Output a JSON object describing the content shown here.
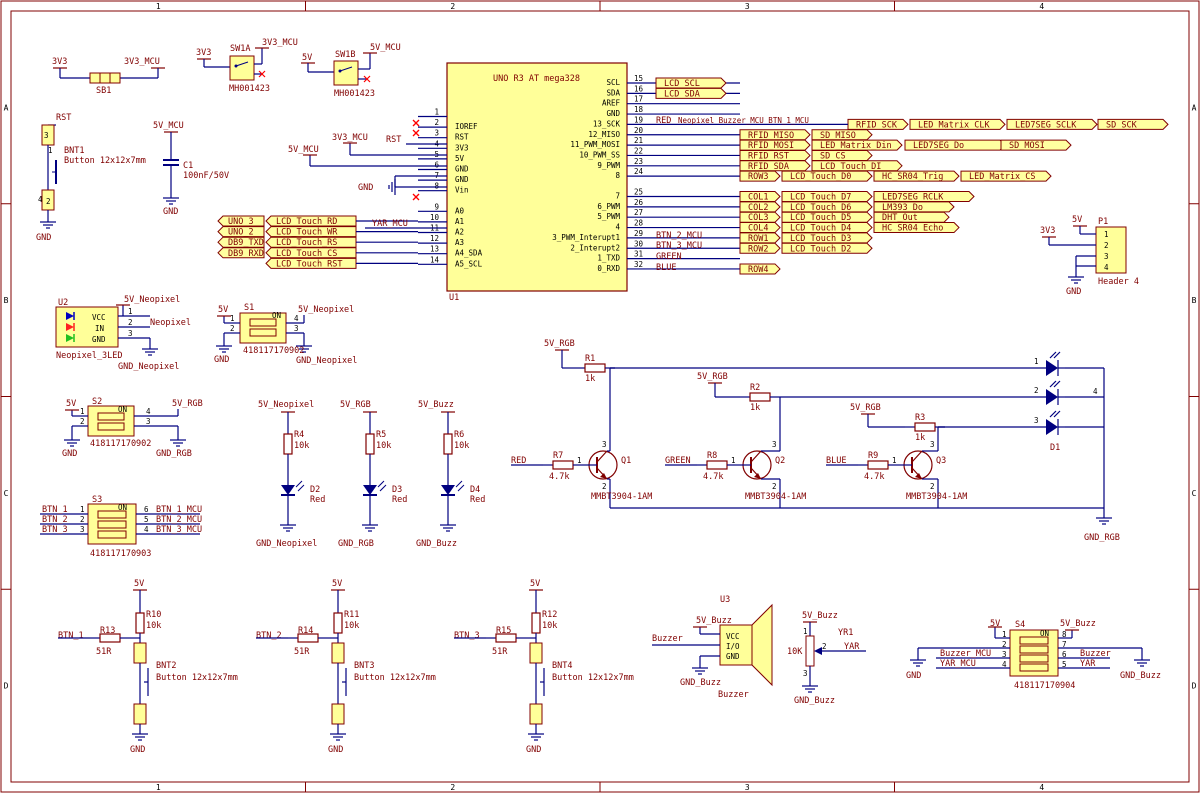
{
  "colors": {
    "wire": "#000080",
    "label": "#800000",
    "body": "#ffff99",
    "body_border": "#800000",
    "port_fill": "#ffffa0",
    "frame": "#800000",
    "nc": "#ff0000"
  },
  "frame": {
    "columns": [
      "1",
      "2",
      "3",
      "4"
    ],
    "rows": [
      "A",
      "B",
      "C",
      "D"
    ]
  },
  "u1": {
    "ref": "U1",
    "title": "UNO R3 AT mega328",
    "left_pins": [
      {
        "num": "1",
        "name": "",
        "net": ""
      },
      {
        "num": "2",
        "name": "IOREF",
        "net": ""
      },
      {
        "num": "3",
        "name": "RST",
        "net": "RST"
      },
      {
        "num": "4",
        "name": "3V3",
        "net": "3V3_MCU"
      },
      {
        "num": "5",
        "name": "5V",
        "net": "5V_MCU"
      },
      {
        "num": "6",
        "name": "GND",
        "net": ""
      },
      {
        "num": "7",
        "name": "GND",
        "net": ""
      },
      {
        "num": "8",
        "name": "Vin",
        "net": ""
      },
      {
        "num": "9",
        "name": "A0",
        "net": ""
      },
      {
        "num": "10",
        "name": "A1",
        "net": "YAR_MCU"
      },
      {
        "num": "11",
        "name": "A2",
        "net": ""
      },
      {
        "num": "12",
        "name": "A3",
        "net": ""
      },
      {
        "num": "13",
        "name": "A4_SDA",
        "net": ""
      },
      {
        "num": "14",
        "name": "A5_SCL",
        "net": ""
      }
    ],
    "gnd_label": "GND",
    "right_pins": [
      {
        "num": "15",
        "name": "SCL",
        "net": ""
      },
      {
        "num": "16",
        "name": "SDA",
        "net": ""
      },
      {
        "num": "17",
        "name": "AREF",
        "net": ""
      },
      {
        "num": "18",
        "name": "GND",
        "net": ""
      },
      {
        "num": "19",
        "name": "13_SCK",
        "net": "RED"
      },
      {
        "num": "20",
        "name": "12_MISO",
        "net": ""
      },
      {
        "num": "21",
        "name": "11_PWM_MOSI",
        "net": ""
      },
      {
        "num": "22",
        "name": "10_PWM_SS",
        "net": ""
      },
      {
        "num": "23",
        "name": "9_PWM",
        "net": ""
      },
      {
        "num": "24",
        "name": "8",
        "net": ""
      },
      {
        "num": "25",
        "name": "7",
        "net": ""
      },
      {
        "num": "26",
        "name": "6_PWM",
        "net": ""
      },
      {
        "num": "27",
        "name": "5_PWM",
        "net": ""
      },
      {
        "num": "28",
        "name": "4",
        "net": ""
      },
      {
        "num": "29",
        "name": "3_PWM_Interupt1",
        "net": "BTN_2_MCU"
      },
      {
        "num": "30",
        "name": "2_Interupt2",
        "net": "BTN_3_MCU"
      },
      {
        "num": "31",
        "name": "1_TXD",
        "net": "GREEN"
      },
      {
        "num": "32",
        "name": "0_RXD",
        "net": "BLUE"
      }
    ],
    "pin19_extra": "Neopixel  Buzzer_MCU  BTN_1_MCU",
    "right_ports": [
      [
        "LCD_SCL"
      ],
      [
        "LCD_SDA"
      ],
      [],
      [],
      [
        "RFID_SCK",
        "LED_Matrix_CLK",
        "LED7SEG_SCLK",
        "SD_SCK"
      ],
      [
        "RFID_MISO",
        "SD_MISO"
      ],
      [
        "RFID_MOSI",
        "LED_Matrix_Din",
        "LED7SEG_Do",
        "SD_MOSI"
      ],
      [
        "RFID_RST",
        "SD_CS"
      ],
      [
        "RFID_SDA",
        "LCD_Touch_DI"
      ],
      [
        "ROW3",
        "LCD_Touch_D0",
        "HC_SR04_Trig",
        "LED_Matrix_CS"
      ],
      [
        "COL1",
        "LCD_Touch_D7",
        "LED7SEG_RCLK"
      ],
      [
        "COL2",
        "LCD_Touch_D6",
        "LM393_Do"
      ],
      [
        "COL3",
        "LCD_Touch_D5",
        "DHT_Out"
      ],
      [
        "COL4",
        "LCD_Touch_D4",
        "HC_SR04_Echo"
      ],
      [
        "ROW1",
        "LCD_Touch_D3"
      ],
      [
        "ROW2",
        "LCD_Touch_D2"
      ],
      [],
      [
        "ROW4"
      ]
    ],
    "left_ports": [
      [
        "UNO_3",
        "LCD_Touch_RD"
      ],
      [
        "UNO_2",
        "LCD_Touch_WR"
      ],
      [
        "DB9_TXD",
        "LCD_Touch_RS"
      ],
      [
        "DB9_RXD",
        "LCD_Touch_CS"
      ],
      [
        "",
        "LCD_Touch_RST"
      ]
    ]
  },
  "sb1": {
    "ref": "SB1",
    "left": "3V3",
    "right": "3V3_MCU"
  },
  "sw1a": {
    "ref": "SW1A",
    "part": "MH001423",
    "left": "3V3",
    "right": "3V3_MCU"
  },
  "sw1b": {
    "ref": "SW1B",
    "part": "MH001423",
    "left": "5V",
    "right": "5V_MCU"
  },
  "bnt1": {
    "ref": "BNT1",
    "part": "Button 12x12x7mm",
    "net": "RST",
    "gnd": "GND",
    "pins": [
      "3",
      "1",
      "4",
      "2"
    ]
  },
  "c1": {
    "ref": "C1",
    "value": "100nF/50V",
    "top": "5V_MCU",
    "gnd": "GND"
  },
  "p1": {
    "ref": "P1",
    "part": "Header 4",
    "pins": [
      "1",
      "2",
      "3",
      "4"
    ],
    "v5": "5V",
    "v33": "3V3",
    "gnd": "GND"
  },
  "u2": {
    "ref": "U2",
    "part": "Neopixel_3LED",
    "pins": [
      "VCC",
      "IN",
      "GND"
    ],
    "nums": [
      "1",
      "2",
      "3"
    ],
    "vcc": "5V_Neopixel",
    "in": "Neopixel",
    "gnd": "GND_Neopixel"
  },
  "s1": {
    "ref": "S1",
    "part": "418117170902",
    "on": "ON",
    "v": "5V",
    "out": "5V_Neopixel",
    "gnd": "GND",
    "gnd_out": "GND_Neopixel",
    "nums": [
      "1",
      "2",
      "3",
      "4"
    ]
  },
  "s2": {
    "ref": "S2",
    "part": "418117170902",
    "on": "ON",
    "v": "5V",
    "out": "5V_RGB",
    "gnd": "GND",
    "gnd_out": "GND_RGB",
    "nums": [
      "1",
      "2",
      "3",
      "4"
    ]
  },
  "s3": {
    "ref": "S3",
    "part": "418117170903",
    "on": "ON",
    "left": [
      "BTN_1",
      "BTN_2",
      "BTN_3"
    ],
    "right": [
      "BTN_1_MCU",
      "BTN_2_MCU",
      "BTN_3_MCU"
    ],
    "nums_l": [
      "1",
      "2",
      "3"
    ],
    "nums_r": [
      "6",
      "5",
      "4"
    ]
  },
  "s4": {
    "ref": "S4",
    "part": "418117170904",
    "on": "ON",
    "left": [
      "5V",
      "",
      "Buzzer_MCU",
      "YAR_MCU"
    ],
    "right": [
      "5V_Buzz",
      "",
      "Buzzer",
      "YAR"
    ],
    "nums_l": [
      "1",
      "2",
      "3",
      "4"
    ],
    "nums_r": [
      "8",
      "7",
      "6",
      "5"
    ],
    "gnd_l": "GND",
    "gnd_r": "GND_Buzz"
  },
  "leds": [
    {
      "r": "R4",
      "rv": "10k",
      "d": "D2",
      "dv": "Red",
      "v": "5V_Neopixel",
      "gnd": "GND_Neopixel"
    },
    {
      "r": "R5",
      "rv": "10k",
      "d": "D3",
      "dv": "Red",
      "v": "5V_RGB",
      "gnd": "GND_RGB"
    },
    {
      "r": "R6",
      "rv": "10k",
      "d": "D4",
      "dv": "Red",
      "v": "5V_Buzz",
      "gnd": "GND_Buzz"
    }
  ],
  "rgb": {
    "rows": [
      {
        "v": "5V_RGB",
        "r": "R1",
        "rv": "1k",
        "in": "RED",
        "rb": "R7",
        "rbv": "4.7k",
        "q": "Q1",
        "qv": "MMBT3904-1AM",
        "led": "1"
      },
      {
        "v": "5V_RGB",
        "r": "R2",
        "rv": "1k",
        "in": "GREEN",
        "rb": "R8",
        "rbv": "4.7k",
        "q": "Q2",
        "qv": "MMBT3904-1AM",
        "led": "2"
      },
      {
        "v": "5V_RGB",
        "r": "R3",
        "rv": "1k",
        "in": "BLUE",
        "rb": "R9",
        "rbv": "4.7k",
        "q": "Q3",
        "qv": "MMBT3904-1AM",
        "led": "3"
      }
    ],
    "d1": "D1",
    "common": "4",
    "gnd": "GND_RGB",
    "q_pins": [
      "1",
      "2",
      "3"
    ]
  },
  "buttons": [
    {
      "v": "5V",
      "pr": "R10",
      "prv": "10k",
      "net": "BTN_1",
      "r": "R13",
      "rv": "51R",
      "b": "BNT2",
      "bv": "Button 12x12x7mm",
      "gnd": "GND"
    },
    {
      "v": "5V",
      "pr": "R11",
      "prv": "10k",
      "net": "BTN_2",
      "r": "R14",
      "rv": "51R",
      "b": "BNT3",
      "bv": "Button 12x12x7mm",
      "gnd": "GND"
    },
    {
      "v": "5V",
      "pr": "R12",
      "prv": "10k",
      "net": "BTN_3",
      "r": "R15",
      "rv": "51R",
      "b": "BNT4",
      "bv": "Button 12x12x7mm",
      "gnd": "GND"
    }
  ],
  "u3": {
    "ref": "U3",
    "part": "Buzzer",
    "pins": [
      "VCC",
      "I/O",
      "GND"
    ],
    "vcc": "5V_Buzz",
    "io": "Buzzer",
    "gnd": "GND_Buzz"
  },
  "yr1": {
    "ref": "YR1",
    "value": "10K",
    "pin2": "2",
    "net": "YAR",
    "v": "5V_Buzz",
    "gnd": "GND_Buzz",
    "pins": [
      "1",
      "3"
    ]
  }
}
